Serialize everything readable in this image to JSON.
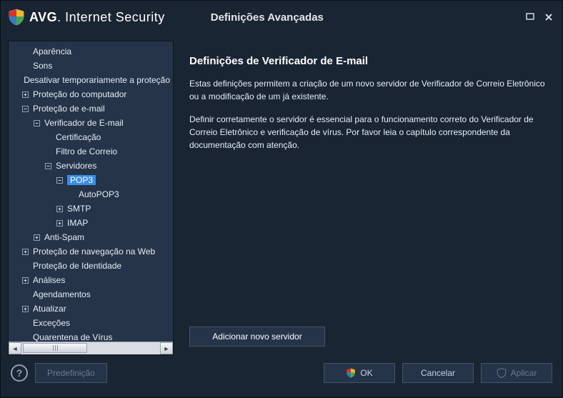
{
  "window": {
    "brand_bold": "AVG",
    "brand_rest": ". Internet Security",
    "subtitle": "Definições Avançadas"
  },
  "tree": [
    {
      "indent": 0,
      "expander": "",
      "label": "Aparência"
    },
    {
      "indent": 0,
      "expander": "",
      "label": "Sons"
    },
    {
      "indent": 0,
      "expander": "",
      "label": "Desativar temporariamente a proteção"
    },
    {
      "indent": 0,
      "expander": "+",
      "label": "Proteção do computador"
    },
    {
      "indent": 0,
      "expander": "−",
      "label": "Proteção de e-mail"
    },
    {
      "indent": 1,
      "expander": "−",
      "label": "Verificador de E-mail"
    },
    {
      "indent": 2,
      "expander": "",
      "label": "Certificação"
    },
    {
      "indent": 2,
      "expander": "",
      "label": "Filtro de Correio"
    },
    {
      "indent": 2,
      "expander": "−",
      "label": "Servidores"
    },
    {
      "indent": 3,
      "expander": "−",
      "label": "POP3",
      "selected": true
    },
    {
      "indent": 4,
      "expander": "",
      "label": "AutoPOP3"
    },
    {
      "indent": 3,
      "expander": "+",
      "label": "SMTP"
    },
    {
      "indent": 3,
      "expander": "+",
      "label": "IMAP"
    },
    {
      "indent": 1,
      "expander": "+",
      "label": "Anti-Spam"
    },
    {
      "indent": 0,
      "expander": "+",
      "label": "Proteção de navegação na Web"
    },
    {
      "indent": 0,
      "expander": "",
      "label": "Proteção de Identidade"
    },
    {
      "indent": 0,
      "expander": "+",
      "label": "Análises"
    },
    {
      "indent": 0,
      "expander": "",
      "label": "Agendamentos"
    },
    {
      "indent": 0,
      "expander": "+",
      "label": "Atualizar"
    },
    {
      "indent": 0,
      "expander": "",
      "label": "Exceções"
    },
    {
      "indent": 0,
      "expander": "",
      "label": "Quarentena de Vírus"
    }
  ],
  "main": {
    "heading": "Definições de Verificador de E-mail",
    "p1": "Estas definições permitem a criação de um novo servidor de Verificador de Correio Eletrônico ou a modificação de um já existente.",
    "p2": "Definir corretamente o servidor é essencial para o funcionamento correto do Verificador de Correio Eletrônico e verificação de vírus. Por favor leia o capítulo correspondente da documentação com atenção.",
    "action": "Adicionar novo servidor"
  },
  "footer": {
    "preset": "Predefinição",
    "ok": "OK",
    "cancel": "Cancelar",
    "apply": "Aplicar"
  }
}
